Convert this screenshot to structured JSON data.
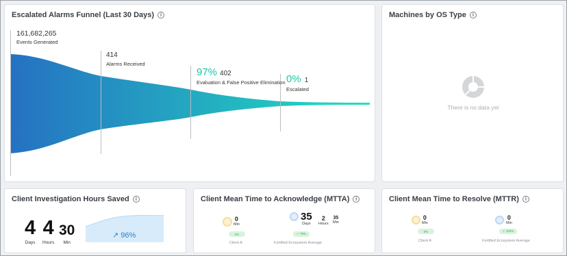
{
  "funnel": {
    "title": "Escalated Alarms Funnel (Last 30 Days)",
    "events": {
      "value": "161,682,265",
      "label": "Events Generated"
    },
    "received": {
      "value": "414",
      "label": "Alarms Received"
    },
    "evaluation": {
      "percent": "97%",
      "value": "402",
      "label": "Evaluation & False Positive Elimination"
    },
    "escalated": {
      "percent": "0%",
      "value": "1",
      "label": "Escalated"
    },
    "colors": {
      "start": "#2571c2",
      "end": "#22e0c0"
    }
  },
  "machines": {
    "title": "Machines by OS Type",
    "empty_text": "There is no data yet"
  },
  "hours_saved": {
    "title": "Client Investigation Hours Saved",
    "days": "4",
    "days_unit": "Days",
    "hours": "4",
    "hours_unit": "Hours",
    "min": "30",
    "min_unit": "Min",
    "trend": "↗ 96%"
  },
  "mtta": {
    "title": "Client Mean Time to Acknowledge (MTTA)",
    "client": {
      "min": "0",
      "min_unit": "Min",
      "badge": "0%",
      "label": "Client A"
    },
    "ecosystem": {
      "days": "35",
      "days_unit": "Days",
      "hours": "2",
      "hours_unit": "Hours",
      "min": "35",
      "min_unit": "Min",
      "badge": "✓ 79%",
      "label": "Fortified Ecosystem Average"
    }
  },
  "mttr": {
    "title": "Client Mean Time to Resolve (MTTR)",
    "client": {
      "min": "0",
      "min_unit": "Min",
      "badge": "0%",
      "label": "Client A"
    },
    "ecosystem": {
      "min": "0",
      "min_unit": "Min",
      "badge": "✓ 100%",
      "label": "Fortified Ecosystem Average"
    }
  }
}
